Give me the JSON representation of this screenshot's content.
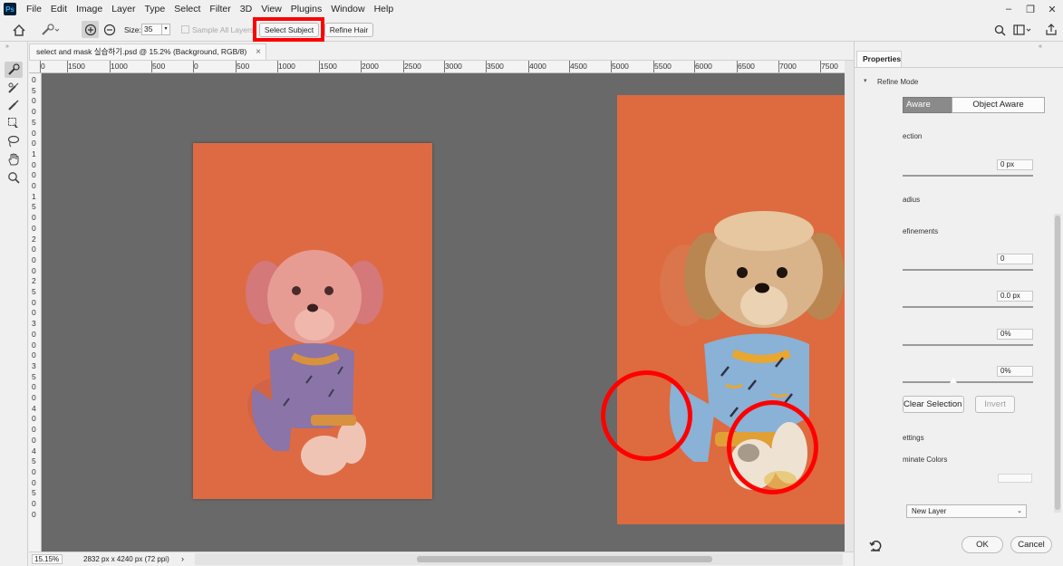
{
  "menubar": {
    "app_icon": "Ps",
    "items": [
      "File",
      "Edit",
      "Image",
      "Layer",
      "Type",
      "Select",
      "Filter",
      "3D",
      "View",
      "Plugins",
      "Window",
      "Help"
    ],
    "window_controls": [
      "–",
      "❐",
      "✕"
    ]
  },
  "options": {
    "size_label": "Size:",
    "size_value": "35",
    "sample_all_layers": "Sample All Layers",
    "select_subject": "Select Subject",
    "refine_hair": "Refine Hair"
  },
  "document": {
    "tab_title": "select and mask 실습하기.psd @ 15.2% (Background, RGB/8)",
    "tab_close": "×",
    "zoom": "15.15%",
    "doc_info": "2832 px x 4240 px (72 ppi)",
    "status_arrow": "›"
  },
  "ruler_top": [
    "0",
    "1500",
    "1000",
    "500",
    "0",
    "500",
    "1000",
    "1500",
    "2000",
    "2500",
    "3000",
    "3500",
    "4000",
    "4500",
    "5000",
    "5500",
    "6000",
    "6500",
    "7000",
    "7500"
  ],
  "ruler_left": [
    "0",
    "5",
    "0",
    "0",
    "5",
    "0",
    "0",
    "1",
    "0",
    "0",
    "0",
    "1",
    "5",
    "0",
    "0",
    "2",
    "0",
    "0",
    "0",
    "2",
    "5",
    "0",
    "0",
    "3",
    "0",
    "0",
    "0",
    "3",
    "5",
    "0",
    "0",
    "4",
    "0",
    "0",
    "0",
    "4",
    "5",
    "0",
    "0",
    "5",
    "0",
    "0"
  ],
  "properties": {
    "tab": "Properties",
    "refine_mode": "Refine Mode",
    "mode_left": "Aware",
    "mode_right": "Object Aware",
    "edge_detection": "ection",
    "radius_value": "0 px",
    "smart_radius": "adius",
    "global_refinements": "efinements",
    "smooth_value": "0",
    "feather_value": "0.0 px",
    "contrast_value": "0%",
    "shift_edge_value": "0%",
    "clear_selection": "Clear Selection",
    "invert": "Invert",
    "output_settings": "ettings",
    "decontaminate": "minate Colors",
    "output_to": "New Layer",
    "ok": "OK",
    "cancel": "Cancel"
  },
  "colors": {
    "canvas_bg": "#696969",
    "photo_orange": "#de6a3f",
    "highlight": "#ff0000"
  }
}
